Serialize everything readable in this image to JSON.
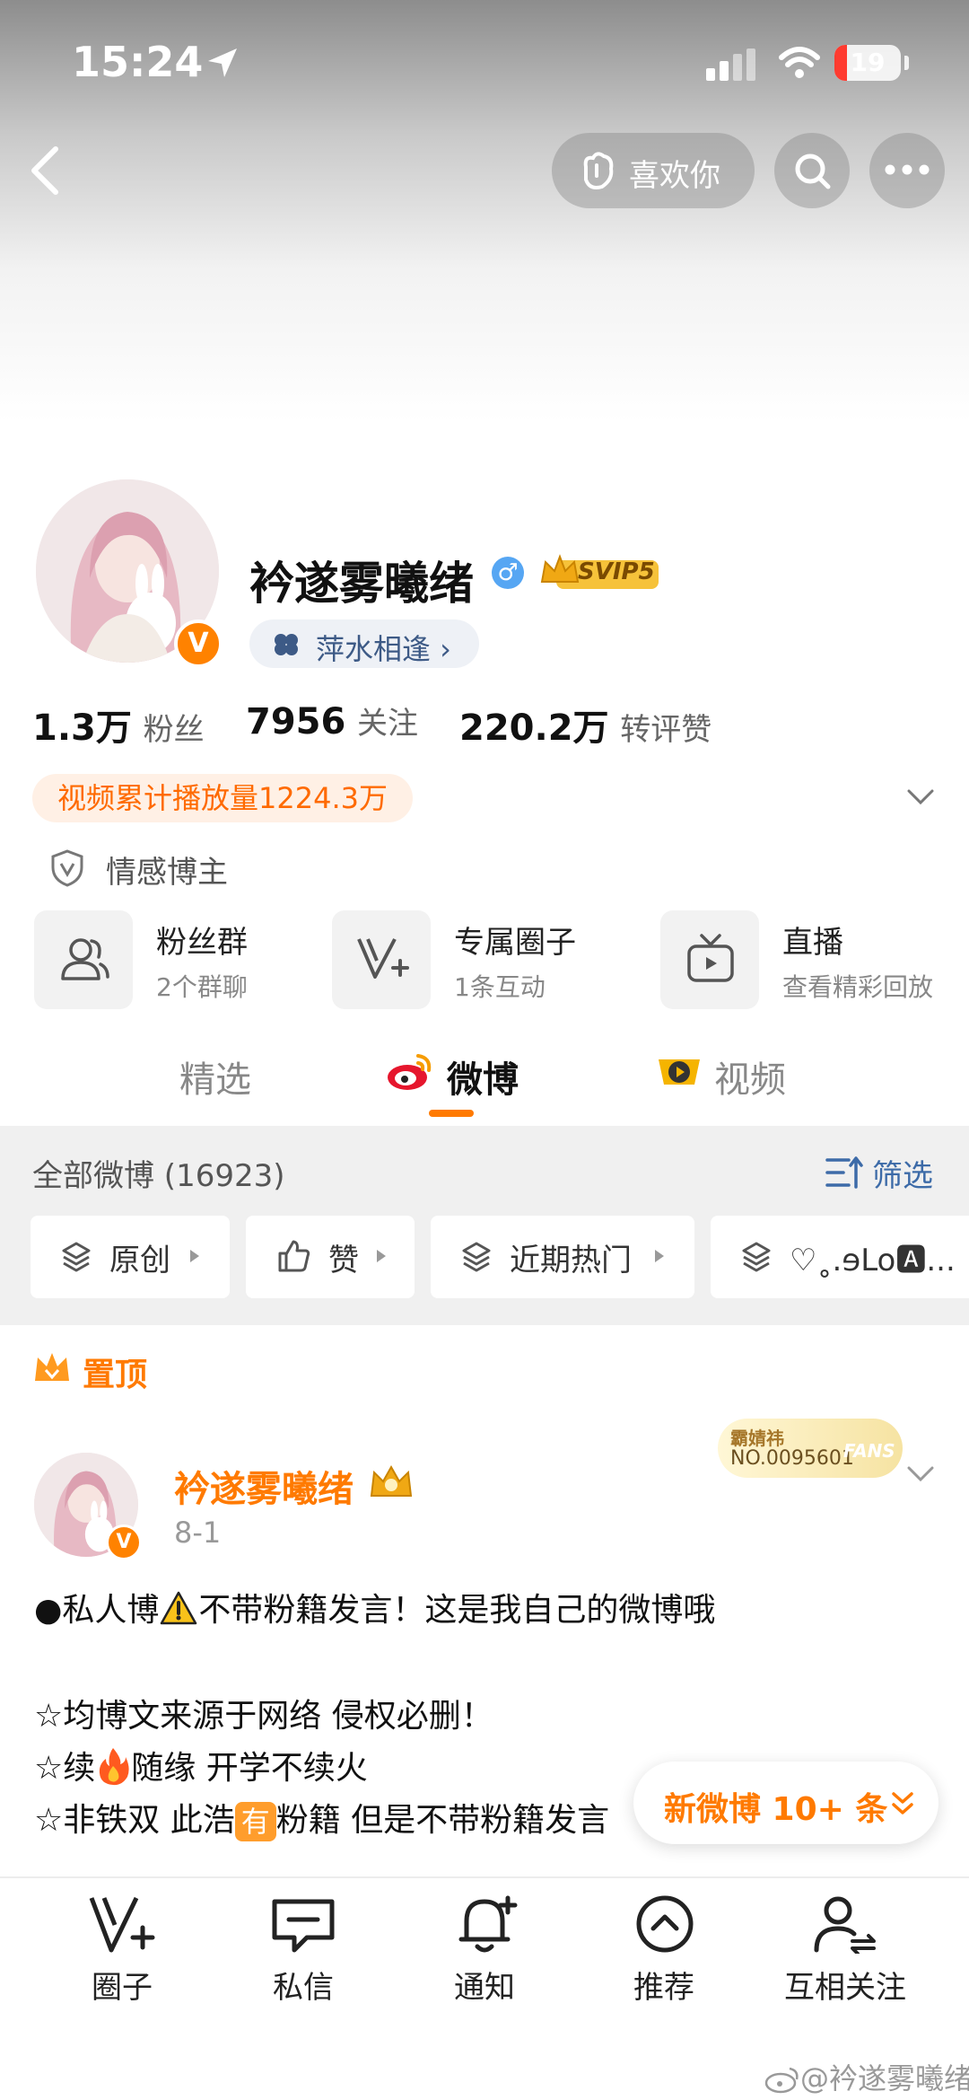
{
  "status_bar": {
    "time": "15:24",
    "battery": "19"
  },
  "header": {
    "like_label": "喜欢你"
  },
  "profile": {
    "name": "衿遂雾曦绪",
    "svip": "SVIP5",
    "tag": "萍水相逢 ›",
    "verified_badge": "V",
    "gender_icon": "♂",
    "stats": [
      {
        "value": "1.3万",
        "label": "粉丝"
      },
      {
        "value": "7956",
        "label": "关注"
      },
      {
        "value": "220.2万",
        "label": "转评赞"
      }
    ],
    "video_plays": "视频累计播放量1224.3万",
    "cert": "情感博主"
  },
  "entries": [
    {
      "title": "粉丝群",
      "sub": "2个群聊",
      "icon": "group-icon"
    },
    {
      "title": "专属圈子",
      "sub": "1条互动",
      "icon": "circle-v-icon"
    },
    {
      "title": "直播",
      "sub": "查看精彩回放",
      "icon": "tv-icon"
    }
  ],
  "tabs": [
    {
      "label": "精选"
    },
    {
      "label": "微博"
    },
    {
      "label": "视频"
    }
  ],
  "feed": {
    "all_label": "全部微博 (16923)",
    "filter_label": "筛选",
    "chips": [
      {
        "label": "原创"
      },
      {
        "label": "赞"
      },
      {
        "label": "近期热门"
      },
      {
        "label": "♡˳.ɘLo🅰..."
      }
    ]
  },
  "post": {
    "pin_label": "置顶",
    "author": "衿遂雾曦绪",
    "date": "8-1",
    "fans_card": {
      "line1": "霸婧祎",
      "line2": "NO.0095601",
      "badge": "FANS"
    },
    "lines": [
      {
        "parts": [
          "●私人博",
          "不带粉籍发言！这是我自己的微博哦"
        ]
      },
      {
        "parts": [
          "☆均博文来源于网络 侵权必删！"
        ]
      },
      {
        "parts": [
          "☆续",
          "随缘 开学不续火"
        ]
      },
      {
        "parts": [
          "☆非铁双 此浩",
          "有",
          "粉籍 但是不带粉籍发言"
        ]
      }
    ],
    "new_posts": "新微博 10+ 条"
  },
  "bottom_nav": [
    {
      "label": "圈子",
      "icon": "circle-v-icon"
    },
    {
      "label": "私信",
      "icon": "chat-icon"
    },
    {
      "label": "通知",
      "icon": "bell-icon"
    },
    {
      "label": "推荐",
      "icon": "chevron-up-circle-icon"
    },
    {
      "label": "互相关注",
      "icon": "mutual-follow-icon"
    }
  ],
  "watermark": "@衿遂雾曦绪",
  "colors": {
    "accent": "#ff7a00",
    "link_blue": "#3d6ba8",
    "vip_orange": "#ff8200"
  }
}
